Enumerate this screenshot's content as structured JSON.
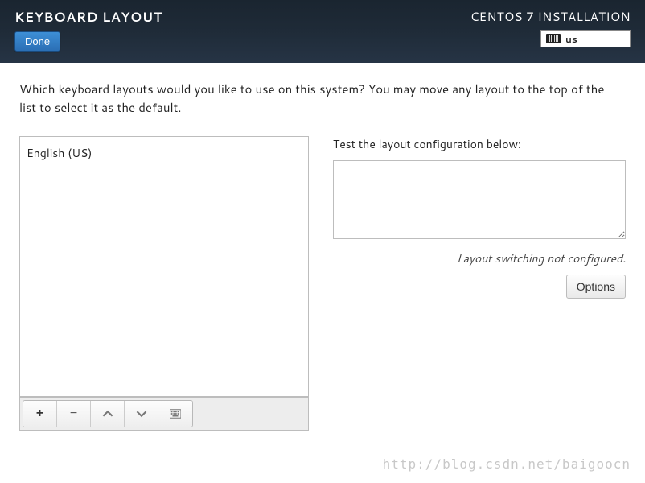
{
  "header": {
    "title": "KEYBOARD LAYOUT",
    "done_label": "Done",
    "install_title": "CENTOS 7 INSTALLATION",
    "lang_code": "us"
  },
  "instruction": "Which keyboard layouts would you like to use on this system?  You may move any layout to the top of the list to select it as the default.",
  "layouts": {
    "items": [
      "English (US)"
    ]
  },
  "test": {
    "label": "Test the layout configuration below:",
    "value": ""
  },
  "switch_note": "Layout switching not configured.",
  "options_label": "Options",
  "toolbar": {
    "add": "+",
    "remove": "−"
  },
  "watermark": "http://blog.csdn.net/baigoocn"
}
